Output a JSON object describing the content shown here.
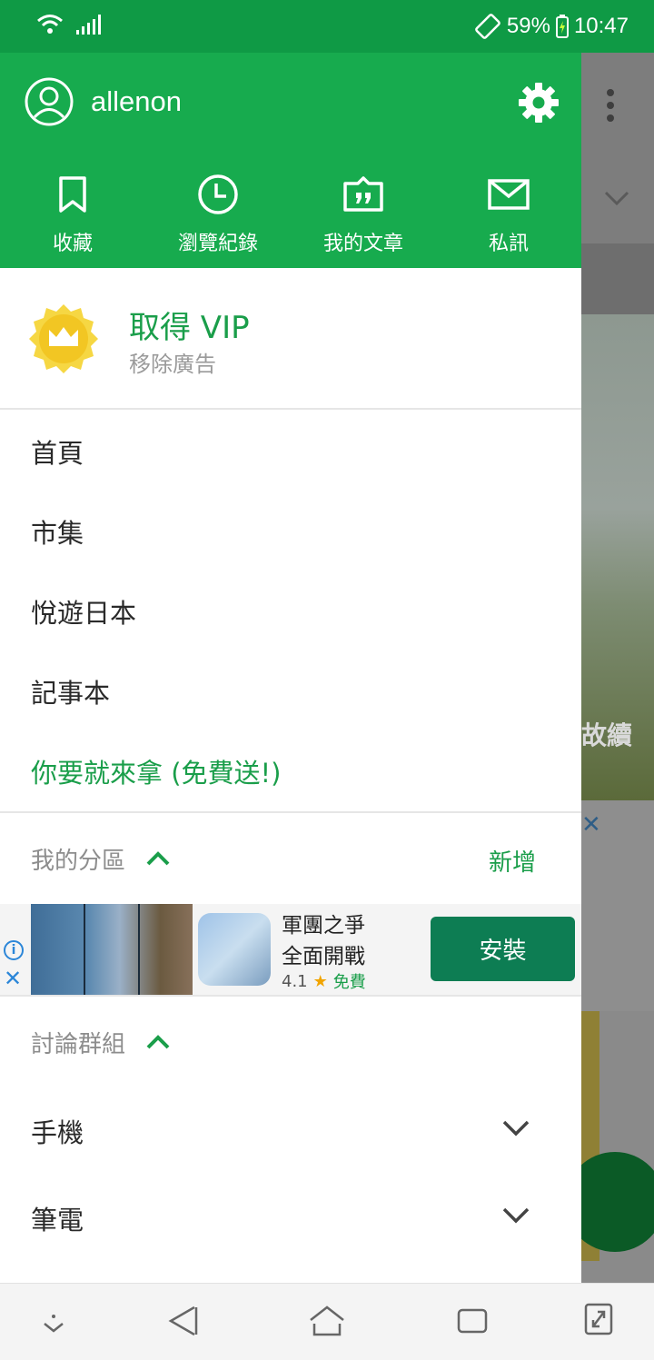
{
  "status_bar": {
    "battery": "59%",
    "time": "10:47",
    "icons": [
      "wifi-icon",
      "signal-icon",
      "rotate-icon",
      "battery-charging-icon"
    ]
  },
  "drawer": {
    "username": "allenon",
    "quick_actions": [
      {
        "label": "收藏",
        "icon": "bookmark-icon"
      },
      {
        "label": "瀏覽紀錄",
        "icon": "clock-icon"
      },
      {
        "label": "我的文章",
        "icon": "article-quote-icon"
      },
      {
        "label": "私訊",
        "icon": "mail-icon"
      }
    ],
    "vip": {
      "title": "取得 VIP",
      "subtitle": "移除廣告"
    },
    "menu": [
      {
        "label": "首頁"
      },
      {
        "label": "市集"
      },
      {
        "label": "悅遊日本"
      },
      {
        "label": "記事本"
      },
      {
        "label": "你要就來拿 (免費送!)"
      }
    ],
    "my_section": {
      "title": "我的分區",
      "add_label": "新增"
    },
    "ad": {
      "app_name_line1": "軍團之爭",
      "app_name_line2": "全面開戰",
      "rating": "4.1",
      "price": "免費",
      "install_label": "安裝"
    },
    "groups_section": {
      "title": "討論群組"
    },
    "groups": [
      {
        "label": "手機"
      },
      {
        "label": "筆電"
      }
    ]
  },
  "background_page": {
    "partial_text": "故續"
  },
  "colors": {
    "status_bar": "#0f9a45",
    "header": "#17ab4e",
    "accent": "#1a9e4a",
    "install_button": "#0d7d53"
  }
}
